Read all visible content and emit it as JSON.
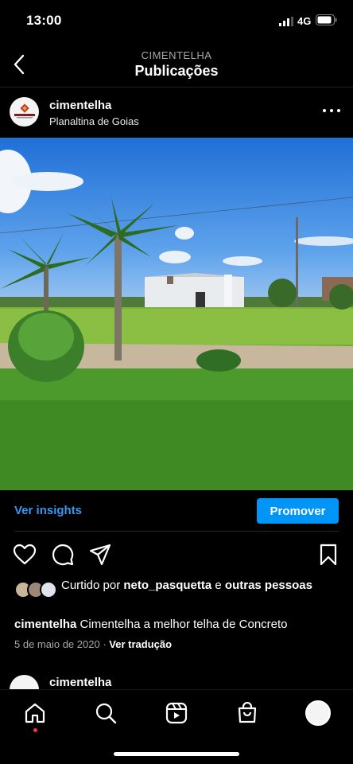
{
  "status_bar": {
    "time": "13:00",
    "network": "4G"
  },
  "header": {
    "subtitle": "CIMENTELHA",
    "title": "Publicações",
    "back_icon": "chevron-left-icon"
  },
  "post": {
    "username": "cimentelha",
    "location": "Planaltina de Goias",
    "avatar_text": "CIMENTELHA",
    "image_subject": "palm trees on grass field with industrial building under blue sky"
  },
  "insights": {
    "link_label": "Ver insights",
    "promote_label": "Promover"
  },
  "actions": {
    "like_icon": "heart-icon",
    "comment_icon": "comment-icon",
    "share_icon": "send-icon",
    "save_icon": "bookmark-icon"
  },
  "likes": {
    "prefix": "Curtido por ",
    "user": "neto_pasquetta",
    "connector": " e ",
    "others": "outras pessoas"
  },
  "caption": {
    "username": "cimentelha",
    "text": " Cimentelha a melhor telha de Concreto"
  },
  "meta": {
    "date": "5 de maio de 2020",
    "separator": " · ",
    "translate": "Ver tradução"
  },
  "next_post": {
    "username": "cimentelha"
  },
  "bottom_nav": {
    "items": [
      "home-icon",
      "search-icon",
      "reels-icon",
      "shop-icon",
      "profile-avatar"
    ]
  },
  "colors": {
    "accent": "#0095f6",
    "link": "#3897f0",
    "notification": "#ff3040",
    "background": "#000000"
  }
}
